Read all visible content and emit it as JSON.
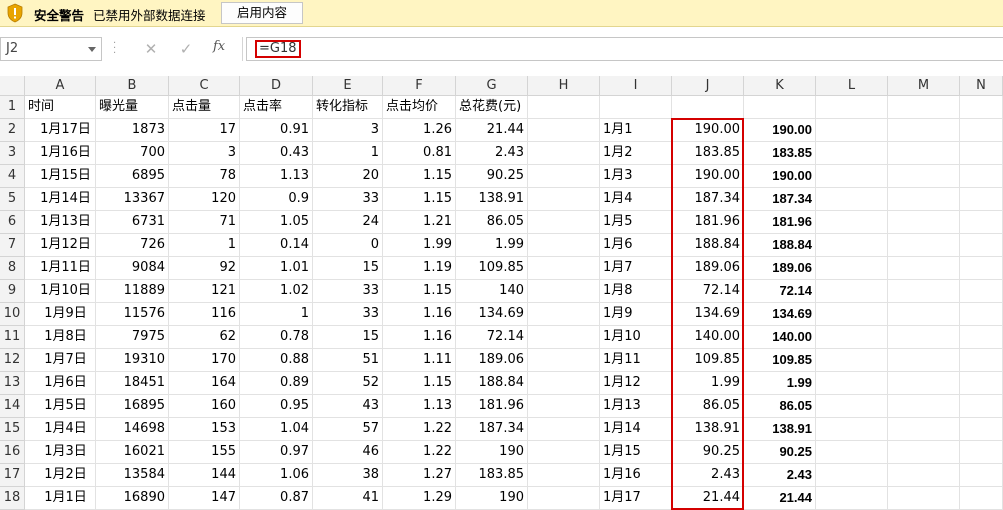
{
  "security_bar": {
    "title": "安全警告",
    "message": "已禁用外部数据连接",
    "button_label": "启用内容",
    "icon": "warning-shield-icon"
  },
  "formula_bar": {
    "name_box": "J2",
    "cancel_icon": "✕",
    "enter_icon": "✓",
    "fx_label": "fx",
    "formula": "=G18"
  },
  "columns": [
    "A",
    "B",
    "C",
    "D",
    "E",
    "F",
    "G",
    "H",
    "I",
    "J",
    "K",
    "L",
    "M",
    "N"
  ],
  "header_row": [
    "时间",
    "曝光量",
    "点击量",
    "点击率",
    "转化指标",
    "点击均价",
    "总花费(元)",
    "",
    "",
    "",
    "",
    "",
    "",
    ""
  ],
  "rows": [
    [
      "1月17日",
      "1873",
      "17",
      "0.91",
      "3",
      "1.26",
      "21.44",
      "",
      "1月1",
      "190.00",
      "190.00",
      "",
      "",
      ""
    ],
    [
      "1月16日",
      "700",
      "3",
      "0.43",
      "1",
      "0.81",
      "2.43",
      "",
      "1月2",
      "183.85",
      "183.85",
      "",
      "",
      ""
    ],
    [
      "1月15日",
      "6895",
      "78",
      "1.13",
      "20",
      "1.15",
      "90.25",
      "",
      "1月3",
      "190.00",
      "190.00",
      "",
      "",
      ""
    ],
    [
      "1月14日",
      "13367",
      "120",
      "0.9",
      "33",
      "1.15",
      "138.91",
      "",
      "1月4",
      "187.34",
      "187.34",
      "",
      "",
      ""
    ],
    [
      "1月13日",
      "6731",
      "71",
      "1.05",
      "24",
      "1.21",
      "86.05",
      "",
      "1月5",
      "181.96",
      "181.96",
      "",
      "",
      ""
    ],
    [
      "1月12日",
      "726",
      "1",
      "0.14",
      "0",
      "1.99",
      "1.99",
      "",
      "1月6",
      "188.84",
      "188.84",
      "",
      "",
      ""
    ],
    [
      "1月11日",
      "9084",
      "92",
      "1.01",
      "15",
      "1.19",
      "109.85",
      "",
      "1月7",
      "189.06",
      "189.06",
      "",
      "",
      ""
    ],
    [
      "1月10日",
      "11889",
      "121",
      "1.02",
      "33",
      "1.15",
      "140",
      "",
      "1月8",
      "72.14",
      "72.14",
      "",
      "",
      ""
    ],
    [
      "1月9日",
      "11576",
      "116",
      "1",
      "33",
      "1.16",
      "134.69",
      "",
      "1月9",
      "134.69",
      "134.69",
      "",
      "",
      ""
    ],
    [
      "1月8日",
      "7975",
      "62",
      "0.78",
      "15",
      "1.16",
      "72.14",
      "",
      "1月10",
      "140.00",
      "140.00",
      "",
      "",
      ""
    ],
    [
      "1月7日",
      "19310",
      "170",
      "0.88",
      "51",
      "1.11",
      "189.06",
      "",
      "1月11",
      "109.85",
      "109.85",
      "",
      "",
      ""
    ],
    [
      "1月6日",
      "18451",
      "164",
      "0.89",
      "52",
      "1.15",
      "188.84",
      "",
      "1月12",
      "1.99",
      "1.99",
      "",
      "",
      ""
    ],
    [
      "1月5日",
      "16895",
      "160",
      "0.95",
      "43",
      "1.13",
      "181.96",
      "",
      "1月13",
      "86.05",
      "86.05",
      "",
      "",
      ""
    ],
    [
      "1月4日",
      "14698",
      "153",
      "1.04",
      "57",
      "1.22",
      "187.34",
      "",
      "1月14",
      "138.91",
      "138.91",
      "",
      "",
      ""
    ],
    [
      "1月3日",
      "16021",
      "155",
      "0.97",
      "46",
      "1.22",
      "190",
      "",
      "1月15",
      "90.25",
      "90.25",
      "",
      "",
      ""
    ],
    [
      "1月2日",
      "13584",
      "144",
      "1.06",
      "38",
      "1.27",
      "183.85",
      "",
      "1月16",
      "2.43",
      "2.43",
      "",
      "",
      ""
    ],
    [
      "1月1日",
      "16890",
      "147",
      "0.87",
      "41",
      "1.29",
      "190",
      "",
      "1月17",
      "21.44",
      "21.44",
      "",
      "",
      ""
    ]
  ],
  "row_numbers": [
    "1",
    "2",
    "3",
    "4",
    "5",
    "6",
    "7",
    "8",
    "9",
    "10",
    "11",
    "12",
    "13",
    "14",
    "15",
    "16",
    "17",
    "18"
  ],
  "colors": {
    "warning_bar": "#fff5c2",
    "highlight": "#d40000",
    "header_bg": "#f3f3f3"
  }
}
